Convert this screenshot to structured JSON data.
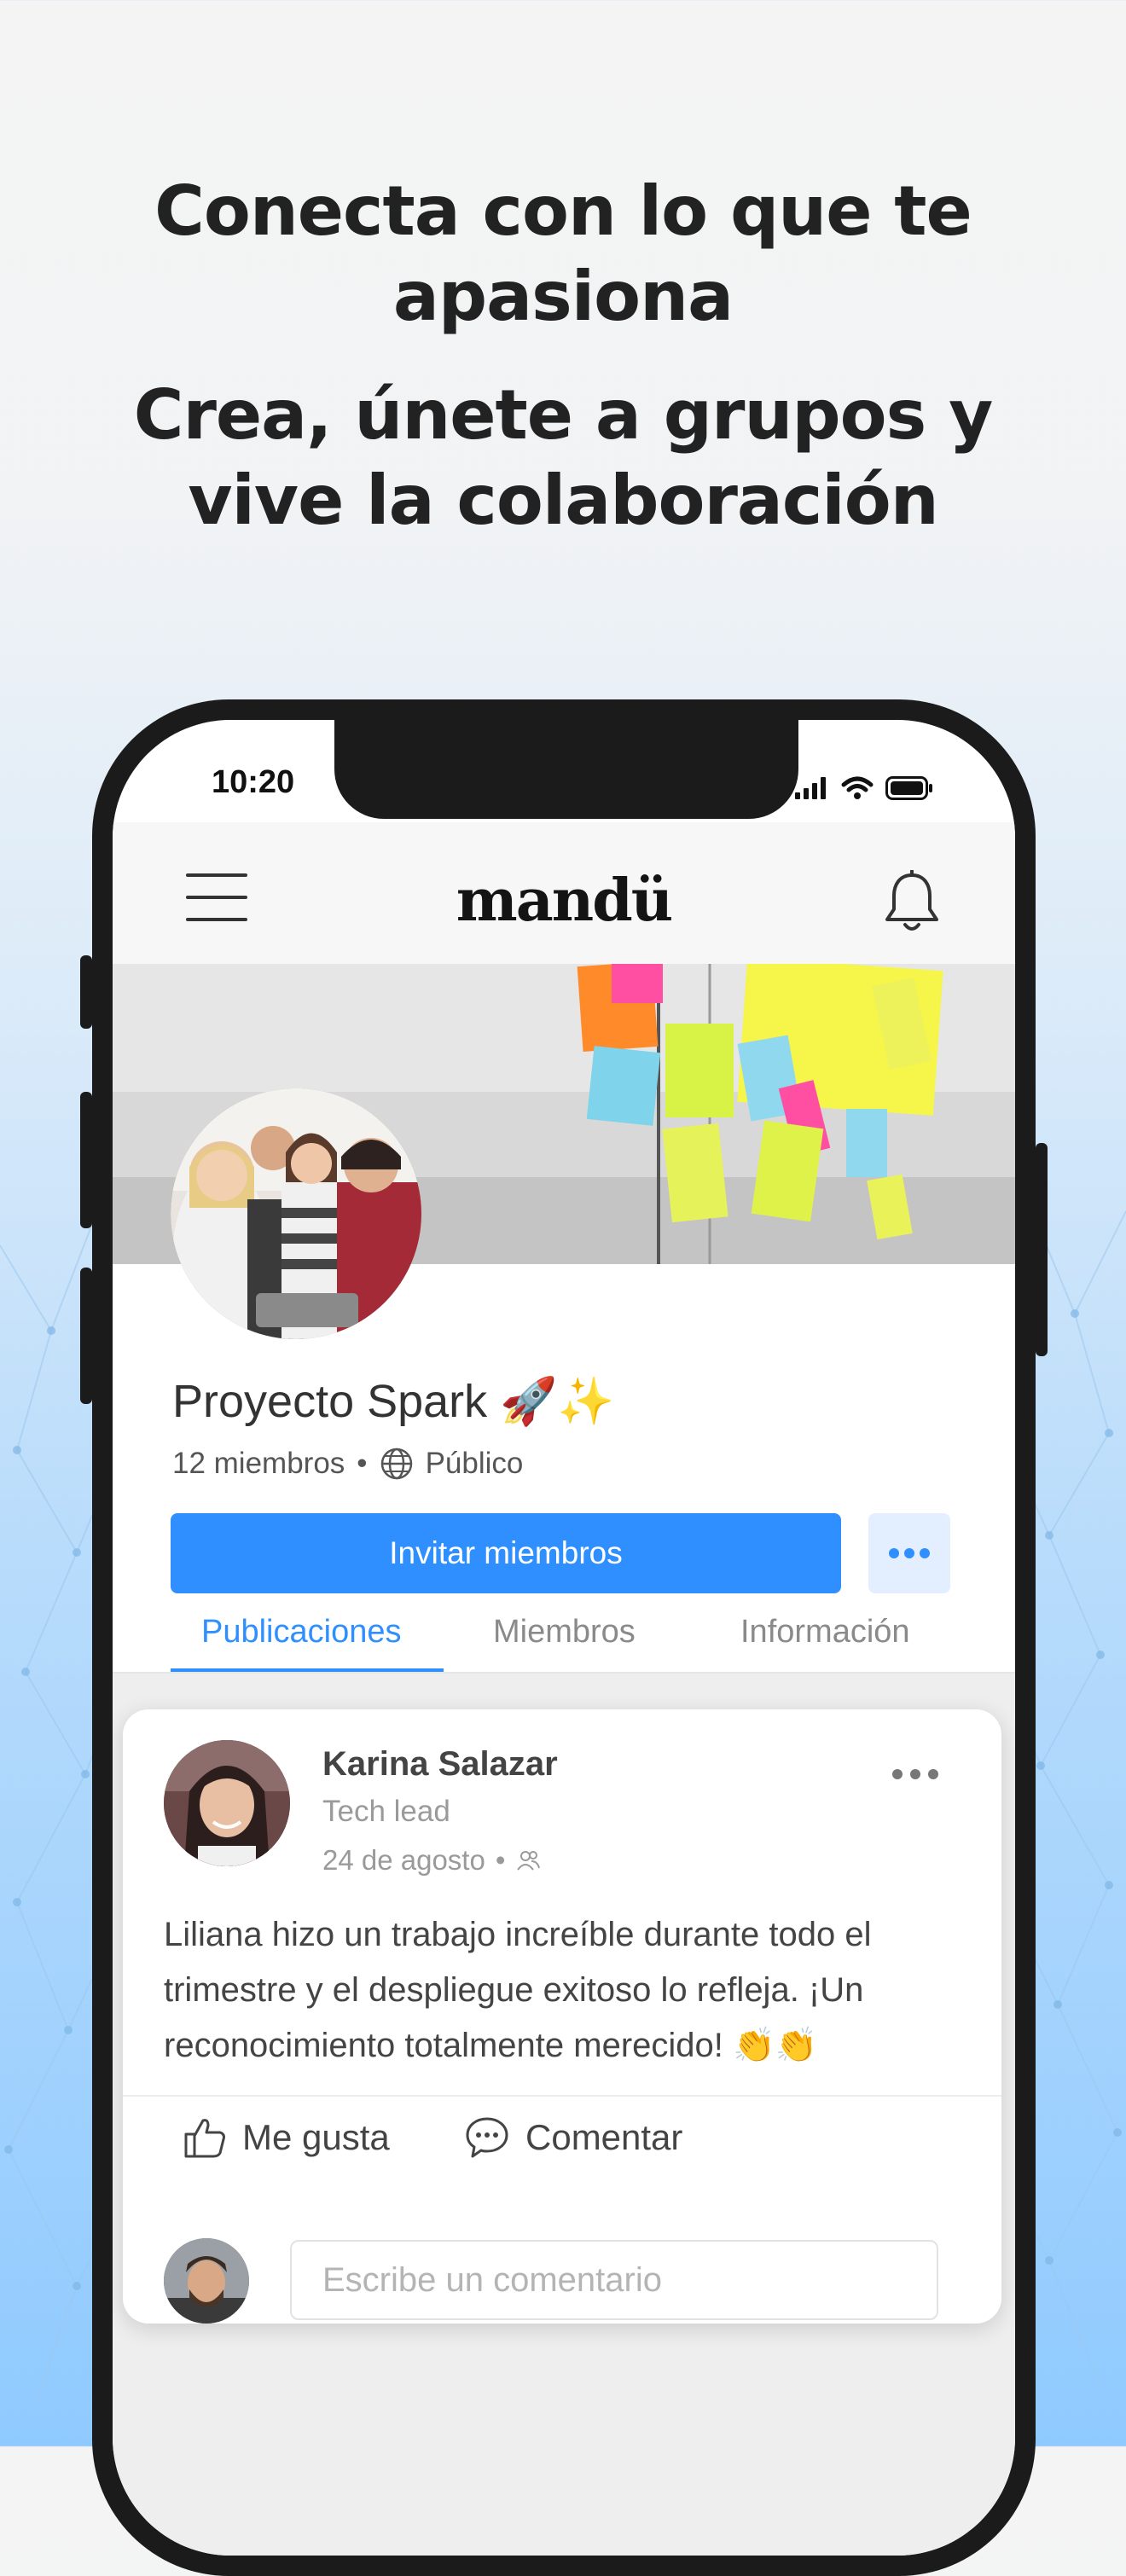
{
  "headline": {
    "line1a": "Conecta con lo que te",
    "line1b": "apasiona",
    "line2a": "Crea, únete a grupos y",
    "line2b": "vive la colaboración"
  },
  "status_bar": {
    "time": "10:20"
  },
  "app": {
    "logo": "mandü"
  },
  "group": {
    "name": "Proyecto Spark 🚀✨",
    "members": "12 miembros",
    "separator": "•",
    "visibility": "Público",
    "invite_label": "Invitar miembros"
  },
  "tabs": [
    {
      "label": "Publicaciones",
      "active": true
    },
    {
      "label": "Miembros",
      "active": false
    },
    {
      "label": "Información",
      "active": false
    }
  ],
  "post": {
    "author": "Karina Salazar",
    "role": "Tech lead",
    "date": "24 de agosto",
    "separator": "•",
    "text": "Liliana hizo un trabajo increíble durante todo el trimestre y el despliegue exitoso lo refleja. ¡Un reconocimiento totalmente merecido! 👏👏",
    "like_label": "Me gusta",
    "comment_label": "Comentar",
    "comment_placeholder": "Escribe un comentario"
  },
  "colors": {
    "accent": "#2f8fff",
    "accent_light": "#e3efff",
    "text": "#222222"
  }
}
